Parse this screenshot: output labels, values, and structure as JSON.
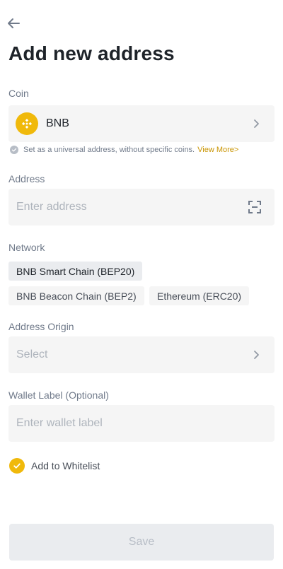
{
  "header": {
    "title": "Add new address"
  },
  "coin": {
    "label": "Coin",
    "name": "BNB",
    "universal_text": "Set as a universal address, without specific coins.",
    "view_more": "View More>"
  },
  "address": {
    "label": "Address",
    "placeholder": "Enter address"
  },
  "network": {
    "label": "Network",
    "options": [
      "BNB Smart Chain (BEP20)",
      "BNB Beacon Chain (BEP2)",
      "Ethereum (ERC20)"
    ],
    "selected": "BNB Smart Chain (BEP20)"
  },
  "origin": {
    "label": "Address Origin",
    "placeholder": "Select"
  },
  "wallet_label": {
    "label": "Wallet Label (Optional)",
    "placeholder": "Enter wallet label"
  },
  "whitelist": {
    "label": "Add to Whitelist",
    "checked": true
  },
  "save": {
    "label": "Save"
  },
  "colors": {
    "accent": "#f0b90b",
    "link": "#c99400",
    "field_bg": "#f5f5f5"
  }
}
